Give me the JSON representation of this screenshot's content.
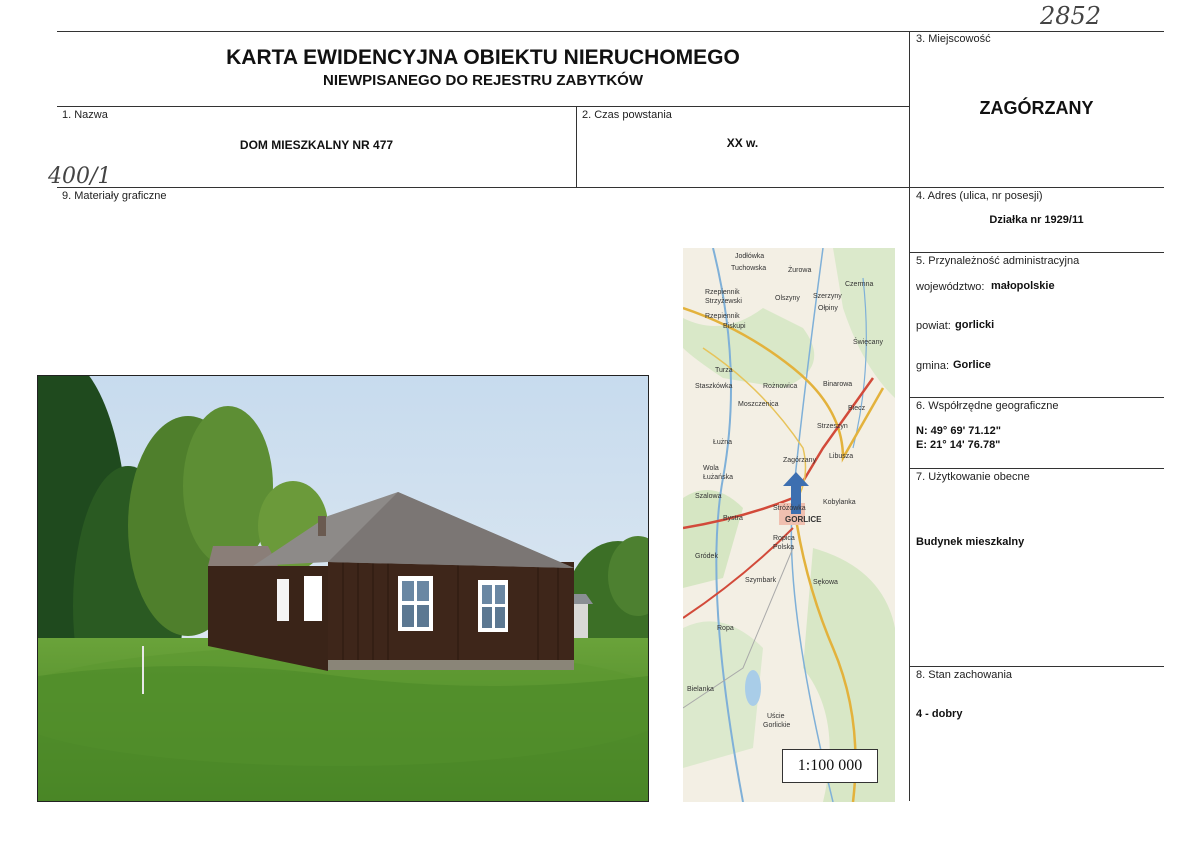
{
  "handwritten": {
    "top_number": "2852",
    "left_number": "400/1"
  },
  "header": {
    "title": "KARTA EWIDENCYJNA OBIEKTU NIERUCHOMEGO",
    "subtitle": "NIEWPISANEGO DO REJESTRU ZABYTKÓW"
  },
  "fields": {
    "nazwa_label": "1. Nazwa",
    "nazwa_value": "DOM MIESZKALNY NR 477",
    "czas_label": "2. Czas powstania",
    "czas_value": "XX w.",
    "miejscowosc_label": "3. Miejscowość",
    "miejscowosc_value": "ZAGÓRZANY",
    "adres_label": "4. Adres (ulica, nr posesji)",
    "adres_value": "Działka nr 1929/11",
    "przynaleznosc_label": "5. Przynależność administracyjna",
    "wojewodztwo_label": "województwo:",
    "wojewodztwo_value": "małopolskie",
    "powiat_label": "powiat:",
    "powiat_value": "gorlicki",
    "gmina_label": "gmina:",
    "gmina_value": "Gorlice",
    "wspolrzedne_label": "6. Współrzędne geograficzne",
    "wspolrzedne_n": "N: 49° 69' 71.12\"",
    "wspolrzedne_e": "E: 21° 14' 76.78\"",
    "uzytkowanie_label": "7. Użytkowanie obecne",
    "uzytkowanie_value": "Budynek mieszkalny",
    "stan_label": "8. Stan zachowania",
    "stan_value": "4 - dobry",
    "materialy_label": "9. Materiały graficzne"
  },
  "map": {
    "scale": "1:100 000",
    "places": [
      "Jodłówka",
      "Tuchowska",
      "Żurowa",
      "Rzepiennik Strzyżewski",
      "Olszyny",
      "Szerzyny",
      "Ołpiny",
      "Rzepiennik Biskupi",
      "Czermna",
      "Święcany",
      "Turza",
      "Staszkówka",
      "Rożnowica",
      "Binarowa",
      "Moszczenica",
      "Biecz",
      "Strzeszyn",
      "Łużna",
      "Zagórzany",
      "Libusza",
      "Wola Łużańska",
      "Szalowa",
      "Bystra",
      "Stróżówka",
      "Kobylanka",
      "Gorlice",
      "Ropica Polska",
      "Sękowa",
      "Gródek",
      "Szymbark",
      "Ropa",
      "Uście Gorlickie",
      "Bielanka"
    ]
  }
}
